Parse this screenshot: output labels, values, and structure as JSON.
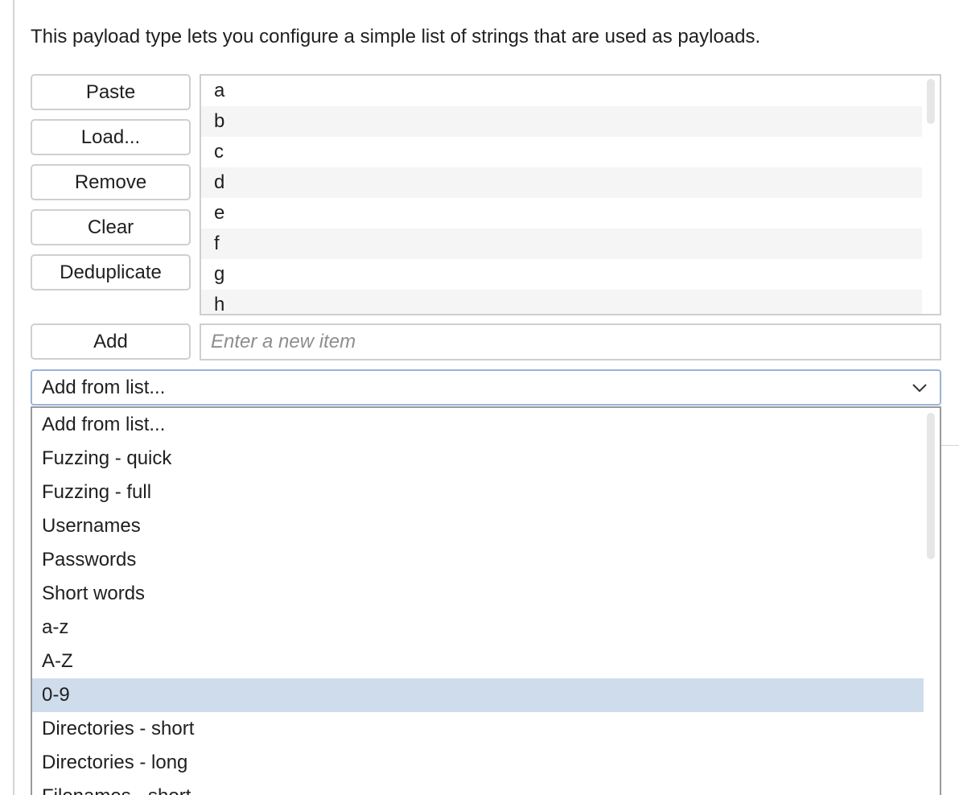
{
  "description": "This payload type lets you configure a simple list of strings that are used as payloads.",
  "buttons": {
    "paste": "Paste",
    "load": "Load...",
    "remove": "Remove",
    "clear": "Clear",
    "deduplicate": "Deduplicate",
    "add": "Add"
  },
  "payload_list": [
    "a",
    "b",
    "c",
    "d",
    "e",
    "f",
    "g",
    "h"
  ],
  "add_input": {
    "placeholder": "Enter a new item",
    "value": ""
  },
  "add_from_list": {
    "selected": "Add from list...",
    "options": [
      "Add from list...",
      "Fuzzing - quick",
      "Fuzzing - full",
      "Usernames",
      "Passwords",
      "Short words",
      "a-z",
      "A-Z",
      "0-9",
      "Directories - short",
      "Directories - long",
      "Filenames - short"
    ],
    "highlighted": "0-9"
  },
  "icons": {
    "dropdown_arrow": "chevron-down-icon"
  },
  "colors": {
    "highlight": "#cfdcec",
    "focus_border": "#9cb3d6",
    "alt_row": "#f5f5f5"
  }
}
